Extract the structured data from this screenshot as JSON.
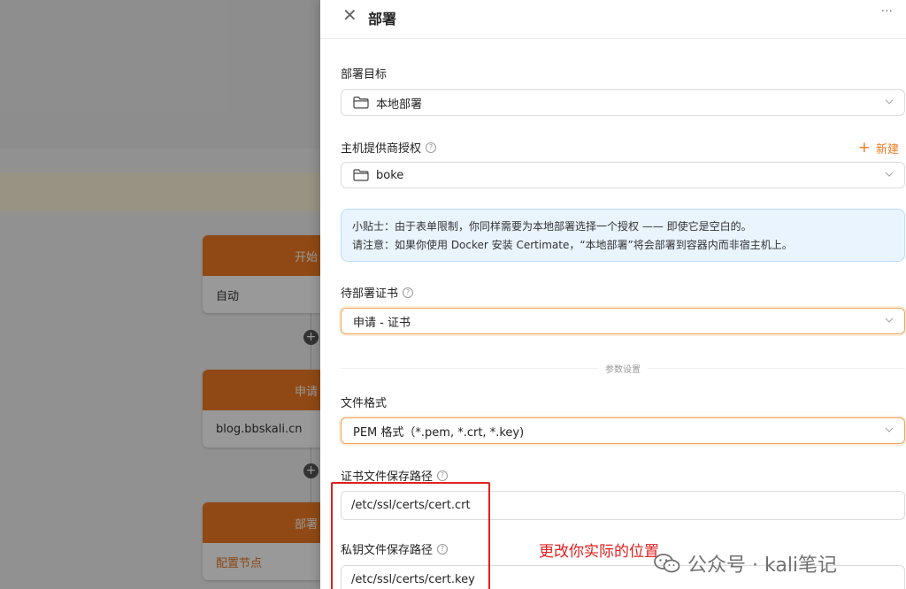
{
  "background": {
    "nodes": [
      {
        "header": "开始",
        "body": "自动"
      },
      {
        "header": "申请",
        "body": "blog.bbskali.cn"
      },
      {
        "header": "部署",
        "body": "配置节点"
      }
    ],
    "add_symbol": "+"
  },
  "drawer": {
    "title": "部署",
    "close_symbol": "✕",
    "more_symbol": "···",
    "target": {
      "label": "部署目标",
      "value": "本地部署"
    },
    "provider": {
      "label": "主机提供商授权",
      "value": "boke",
      "new_label": "新建",
      "new_symbol": "+"
    },
    "tip": {
      "line1": "小贴士：由于表单限制，你同样需要为本地部署选择一个授权 —— 即使它是空白的。",
      "line2": "请注意：如果你使用 Docker 安装 Certimate，“本地部署”将会部署到容器内而非宿主机上。"
    },
    "certificate": {
      "label": "待部署证书",
      "value": "申请 - 证书"
    },
    "params_divider": "参数设置",
    "file_format": {
      "label": "文件格式",
      "value": "PEM 格式（*.pem, *.crt, *.key)"
    },
    "cert_path": {
      "label": "证书文件保存路径",
      "value": "/etc/ssl/certs/cert.crt"
    },
    "key_path": {
      "label": "私钥文件保存路径",
      "value": "/etc/ssl/certs/cert.key"
    },
    "help_symbol": "?"
  },
  "annotation": {
    "text": "更改你实际的位置",
    "color": "#e02020"
  },
  "watermark": {
    "text": "公众号 · kali笔记"
  },
  "colors": {
    "accent": "#f07a22",
    "tip_bg": "#e9f4ff",
    "tip_border": "#bcdcfa"
  }
}
